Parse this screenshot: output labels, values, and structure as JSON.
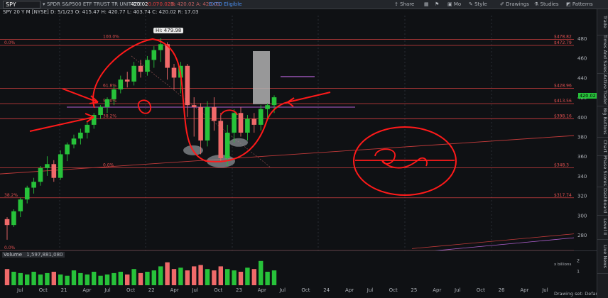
{
  "toolbar": {
    "symbol": "SPY",
    "description": "SPDR S&P500 ETF TRUST TR UNIT ETF",
    "price": "420.02",
    "change": "-0.07",
    "change_pct": "-0.02%",
    "bid": "B: 420.02",
    "ask": "A: 420.03",
    "extra": "EXTO Eligible",
    "share_label": "Share",
    "mo_label": "Mo",
    "style_label": "Style",
    "drawings_label": "Drawings",
    "studies_label": "Studies",
    "patterns_label": "Patterns"
  },
  "subheader": {
    "text": "SPY 20 Y M [NYSE]   D: 5/1/23  O: 415.47  H: 420.77  L: 403.74  C: 420.02  R: 17.03"
  },
  "chart_data": {
    "type": "candlestick",
    "title": "",
    "price_ticks": [
      "480",
      "460",
      "440",
      "420",
      "400",
      "380",
      "360",
      "340",
      "320",
      "300",
      "280"
    ],
    "x_ticks": [
      "Jul",
      "Oct",
      "21",
      "Apr",
      "Jul",
      "Oct",
      "22",
      "Apr",
      "Jul",
      "Oct",
      "23",
      "Apr",
      "Jul",
      "Oct",
      "24",
      "Apr",
      "Jul",
      "Oct",
      "25",
      "Apr",
      "Jul",
      "Oct",
      "26",
      "Apr",
      "Jul"
    ],
    "current_price": "420.02",
    "high_label": "Hi: 479.98",
    "fib_levels": [
      {
        "label": "100.0%",
        "price": "$478.82"
      },
      {
        "label": "0.0%",
        "price": "$472.79"
      },
      {
        "label": "61.8%",
        "price": "$428.96"
      },
      {
        "label": "50.0%",
        "price": "$413.56"
      },
      {
        "label": "38.2%",
        "price": "$398.16"
      },
      {
        "label": "0.0%",
        "price": "$348.3"
      },
      {
        "label": "38.2%",
        "price": "$317.74"
      },
      {
        "label": "0.0%",
        "price": ""
      }
    ],
    "volume_label": "Volume",
    "volume_value": "1,597,881,080",
    "candles_monthly": [
      [
        296,
        290,
        298,
        275
      ],
      [
        290,
        304,
        306,
        288
      ],
      [
        304,
        316,
        318,
        298
      ],
      [
        316,
        328,
        330,
        312
      ],
      [
        328,
        334,
        338,
        322
      ],
      [
        334,
        348,
        350,
        330
      ],
      [
        348,
        352,
        360,
        340
      ],
      [
        352,
        338,
        356,
        334
      ],
      [
        338,
        362,
        366,
        336
      ],
      [
        362,
        372,
        374,
        355
      ],
      [
        372,
        378,
        382,
        368
      ],
      [
        378,
        384,
        388,
        372
      ],
      [
        384,
        392,
        396,
        378
      ],
      [
        392,
        402,
        404,
        388
      ],
      [
        402,
        410,
        412,
        398
      ],
      [
        410,
        418,
        420,
        404
      ],
      [
        418,
        428,
        432,
        412
      ],
      [
        428,
        438,
        442,
        424
      ],
      [
        438,
        436,
        446,
        430
      ],
      [
        436,
        452,
        456,
        432
      ],
      [
        452,
        446,
        458,
        440
      ],
      [
        446,
        458,
        462,
        442
      ],
      [
        458,
        468,
        472,
        450
      ],
      [
        468,
        474,
        480,
        456
      ],
      [
        474,
        450,
        476,
        438
      ],
      [
        450,
        440,
        454,
        428
      ],
      [
        440,
        452,
        456,
        424
      ],
      [
        452,
        412,
        454,
        400
      ],
      [
        412,
        410,
        420,
        380
      ],
      [
        410,
        376,
        414,
        362
      ],
      [
        376,
        410,
        416,
        370
      ],
      [
        410,
        396,
        420,
        386
      ],
      [
        396,
        358,
        404,
        354
      ],
      [
        358,
        384,
        392,
        350
      ],
      [
        384,
        404,
        408,
        374
      ],
      [
        404,
        384,
        410,
        380
      ],
      [
        384,
        398,
        402,
        376
      ],
      [
        398,
        392,
        404,
        384
      ],
      [
        392,
        408,
        412,
        386
      ],
      [
        408,
        412,
        414,
        398
      ],
      [
        412,
        420,
        422,
        404
      ]
    ],
    "volume_values": [
      0.6,
      0.5,
      0.45,
      0.4,
      0.5,
      0.4,
      0.45,
      0.5,
      0.4,
      0.35,
      0.55,
      0.45,
      0.4,
      0.5,
      0.35,
      0.4,
      0.45,
      0.5,
      0.4,
      0.6,
      0.45,
      0.5,
      0.55,
      0.7,
      0.85,
      0.6,
      0.65,
      0.55,
      0.7,
      0.75,
      0.6,
      0.55,
      0.7,
      0.6,
      0.55,
      0.5,
      0.65,
      0.6,
      0.9,
      0.5,
      0.55
    ]
  },
  "xaxis_months": [
    "Jul",
    "Oct",
    "21",
    "Apr",
    "Jul",
    "Oct",
    "22",
    "Apr",
    "Jul",
    "Oct",
    "23",
    "Apr",
    "Jul",
    "Oct",
    "24",
    "Apr",
    "Jul",
    "Oct",
    "25",
    "Apr",
    "Jul",
    "Oct",
    "26",
    "Apr",
    "Jul"
  ],
  "volume_axis": [
    "2",
    "1"
  ],
  "volume_scale": "x billions",
  "drawing_set": "Drawing set: Default",
  "right_tabs": [
    "Trade",
    "Times And Sales",
    "Active Trader",
    "Big Buttons",
    "Chart",
    "Phase Scores",
    "Dashboard",
    "Level II",
    "Live News"
  ],
  "colors": {
    "up": "#27c23a",
    "down": "#f06a6a",
    "annotation": "#ff1a1a",
    "fib": "#d24040",
    "purple": "#b060d0"
  }
}
